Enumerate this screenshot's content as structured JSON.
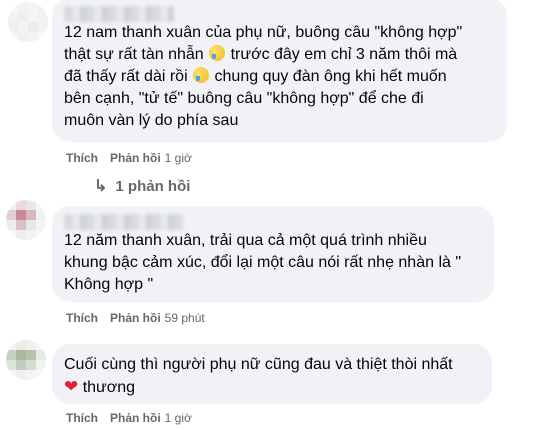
{
  "comments": [
    {
      "text_parts": [
        "12 nam thanh xuân của phụ nữ, buông câu \"không hợp\"\nthật sự rất tàn nhẫn ",
        " trước đây em chỉ 3 năm thôi mà\nđã thấy rất dài rồi ",
        " chung quy đàn ông khi hết muốn\nbên cạnh, \"tử tế\" buông câu \"không hợp\" để che đi\nmuôn vàn lý do phía sau"
      ],
      "like_label": "Thích",
      "reply_label": "Phản hồi",
      "time": "1 giờ"
    },
    {
      "text": "12 năm thanh xuân, trải qua cả một quá trình nhiều\nkhung bậc cảm xúc, đổi lại một câu nói rất nhẹ nhàn là \"\nKhông hợp \"",
      "like_label": "Thích",
      "reply_label": "Phản hồi",
      "time": "59 phút"
    },
    {
      "text_before": "Cuối cùng thì người phụ nữ cũng đau và thiệt thòi nhất\n",
      "text_after": " thương",
      "like_label": "Thích",
      "reply_label": "Phản hồi",
      "time": "1 giờ"
    }
  ],
  "replies_label": "1 phản hồi",
  "icons": {
    "emoji": "crying-face-icon",
    "heart": "red-heart-icon",
    "reply_arrow": "reply-arrow-icon"
  },
  "colors": {
    "bubble": "#f0f2f5",
    "meta": "#65676b",
    "heart": "#e41e3f"
  }
}
